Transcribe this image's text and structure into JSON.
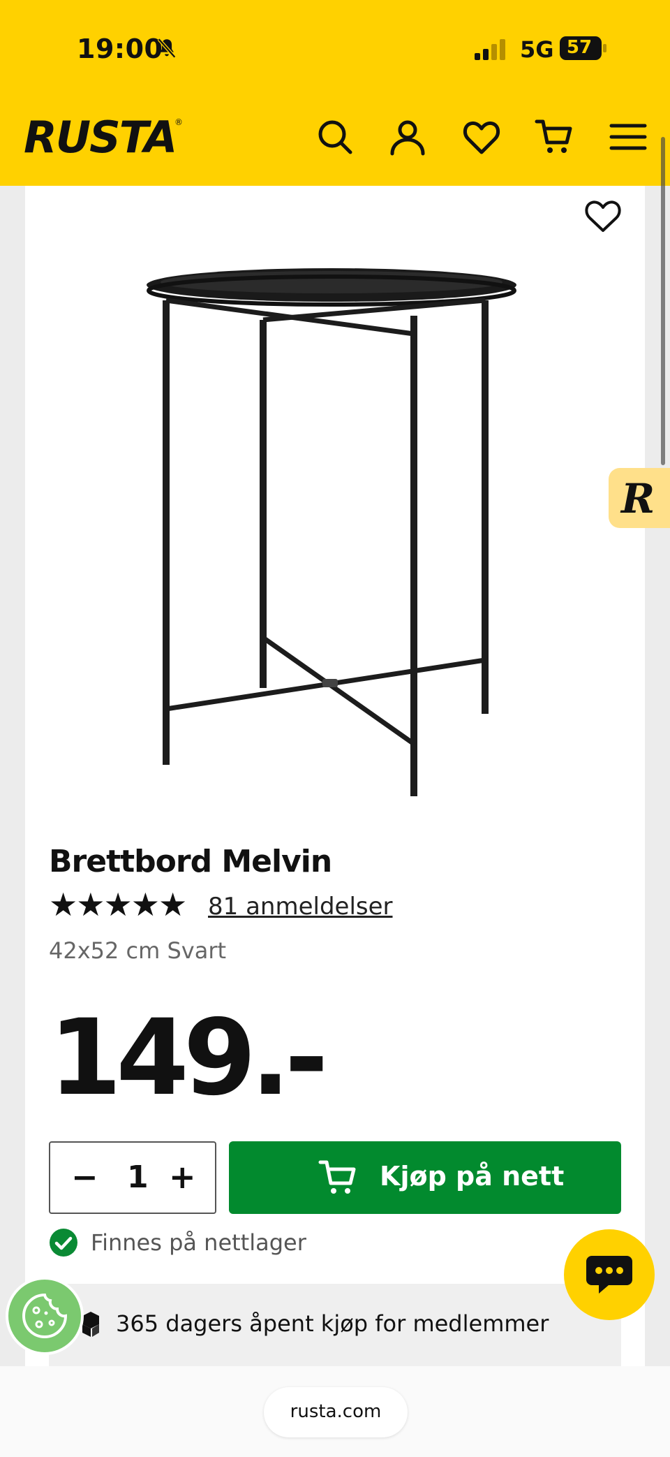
{
  "status_bar": {
    "time": "19:00",
    "network": "5G",
    "battery": "57",
    "icons": [
      "bell-muted-icon",
      "signal-icon",
      "battery-icon"
    ]
  },
  "header": {
    "logo": "RUSTA",
    "logo_mark": "®",
    "icons": [
      "search-icon",
      "account-icon",
      "heart-icon",
      "cart-icon",
      "menu-icon"
    ],
    "accent_color": "#ffd100"
  },
  "product": {
    "title": "Brettbord Melvin",
    "stars": "★★★★★",
    "rating_stars": 5,
    "reviews": "81 anmeldelser",
    "variant": "42x52 cm Svart",
    "price": "149.-",
    "quantity": "1",
    "qty_minus": "−",
    "qty_plus": "+",
    "buy_label": "Kjøp på nett",
    "buy_color": "#028a2e",
    "stock": "Finnes på nettlager",
    "perks": [
      "365 dagers åpent kjøp for medlemmer"
    ]
  },
  "widgets": {
    "badge_letter": "R",
    "chat_icon": "chat-icon",
    "cookie_icon": "cookie-icon"
  },
  "browser": {
    "url": "rusta.com"
  }
}
